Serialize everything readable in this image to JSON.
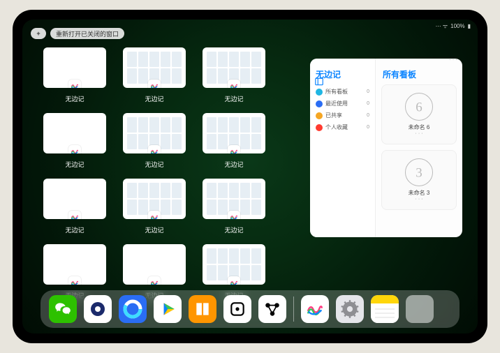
{
  "status": {
    "battery": "100%",
    "wifi": "●"
  },
  "topbar": {
    "plus": "+",
    "reopen": "重新打开已关闭的窗口"
  },
  "app_name": "无边记",
  "windows": [
    {
      "label": "无边记",
      "variant": "blank"
    },
    {
      "label": "无边记",
      "variant": "grid"
    },
    {
      "label": "无边记",
      "variant": "grid"
    },
    {
      "label": "无边记",
      "variant": "blank"
    },
    {
      "label": "无边记",
      "variant": "grid"
    },
    {
      "label": "无边记",
      "variant": "grid"
    },
    {
      "label": "无边记",
      "variant": "blank"
    },
    {
      "label": "无边记",
      "variant": "grid"
    },
    {
      "label": "无边记",
      "variant": "grid"
    },
    {
      "label": "无边记",
      "variant": "blank"
    },
    {
      "label": "无边记",
      "variant": "blank"
    },
    {
      "label": "无边记",
      "variant": "grid"
    }
  ],
  "panel": {
    "title": "无边记",
    "right_title": "所有看板",
    "nav": [
      {
        "label": "所有看板",
        "count": "0",
        "color": "#1fb6e3"
      },
      {
        "label": "最近使用",
        "count": "0",
        "color": "#2a6df4"
      },
      {
        "label": "已共享",
        "count": "0",
        "color": "#f5a623"
      },
      {
        "label": "个人收藏",
        "count": "0",
        "color": "#ff3b30"
      }
    ],
    "boards": [
      {
        "name": "未命名 6",
        "digit": "6"
      },
      {
        "name": "未命名 3",
        "digit": "3"
      }
    ],
    "ellipsis": "···"
  },
  "dock": [
    {
      "name": "wechat",
      "bg": "#2dc100",
      "icon": "wechat"
    },
    {
      "name": "quark",
      "bg": "#ffffff",
      "icon": "circle-blue"
    },
    {
      "name": "qqbrowser",
      "bg": "#2a6df4",
      "icon": "ring-cyan"
    },
    {
      "name": "play",
      "bg": "#ffffff",
      "icon": "play-tri"
    },
    {
      "name": "books",
      "bg": "#ff9500",
      "icon": "books"
    },
    {
      "name": "dice",
      "bg": "#ffffff",
      "icon": "die"
    },
    {
      "name": "nodes",
      "bg": "#ffffff",
      "icon": "nodes"
    },
    {
      "name": "freeform",
      "bg": "#ffffff",
      "icon": "freeform"
    },
    {
      "name": "settings",
      "bg": "#e5e5ea",
      "icon": "gear"
    },
    {
      "name": "notes",
      "bg": "#ffffff",
      "icon": "notes"
    }
  ]
}
